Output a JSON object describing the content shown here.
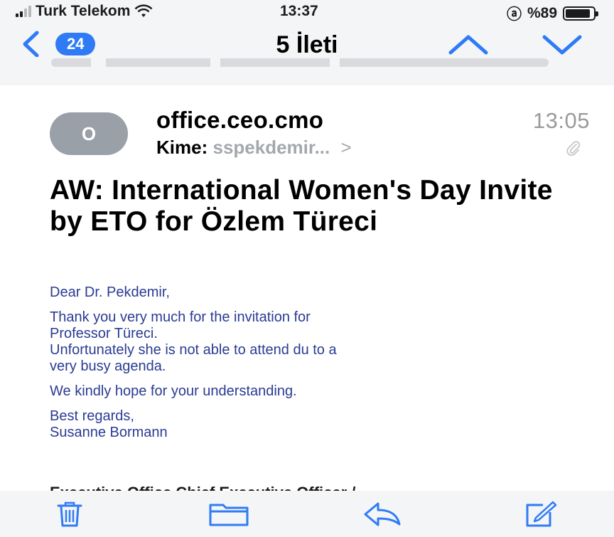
{
  "status_bar": {
    "carrier": "Turk Telekom",
    "time": "13:37",
    "battery_text": "%89",
    "orientation_lock_glyph": "ⓐ",
    "signal_bars": 4,
    "signal_bars_active": 2,
    "battery_level": 0.89
  },
  "nav": {
    "unread_count": "24",
    "title": "5 İleti",
    "accent_color": "#2f7bf6"
  },
  "message": {
    "avatar_initial": "O",
    "sender": "office.ceo.cmo",
    "time": "13:05",
    "to_label": "Kime:",
    "to_value": "sspekdemir...",
    "to_more": ">",
    "has_attachment": true,
    "subject": "AW: International Women's Day Invite by ETO for Özlem Türeci",
    "body": {
      "greeting": "Dear Dr. Pekdemir,",
      "para1_line1": "Thank you very much for the invitation for",
      "para1_line2": "Professor Türeci.",
      "para1_line3": "Unfortunately she is not able to attend du to a",
      "para1_line4": "very busy agenda.",
      "para2": "We kindly hope for your understanding.",
      "signoff": "Best regards,",
      "signature": "Susanne Bormann"
    },
    "footer_partial": "Executive Office Chief Executive Officer /",
    "body_color": "#2a3b93"
  },
  "toolbar": {
    "icons": [
      "trash-icon",
      "folder-icon",
      "reply-icon",
      "compose-icon"
    ],
    "icon_color": "#2f7bf6"
  }
}
